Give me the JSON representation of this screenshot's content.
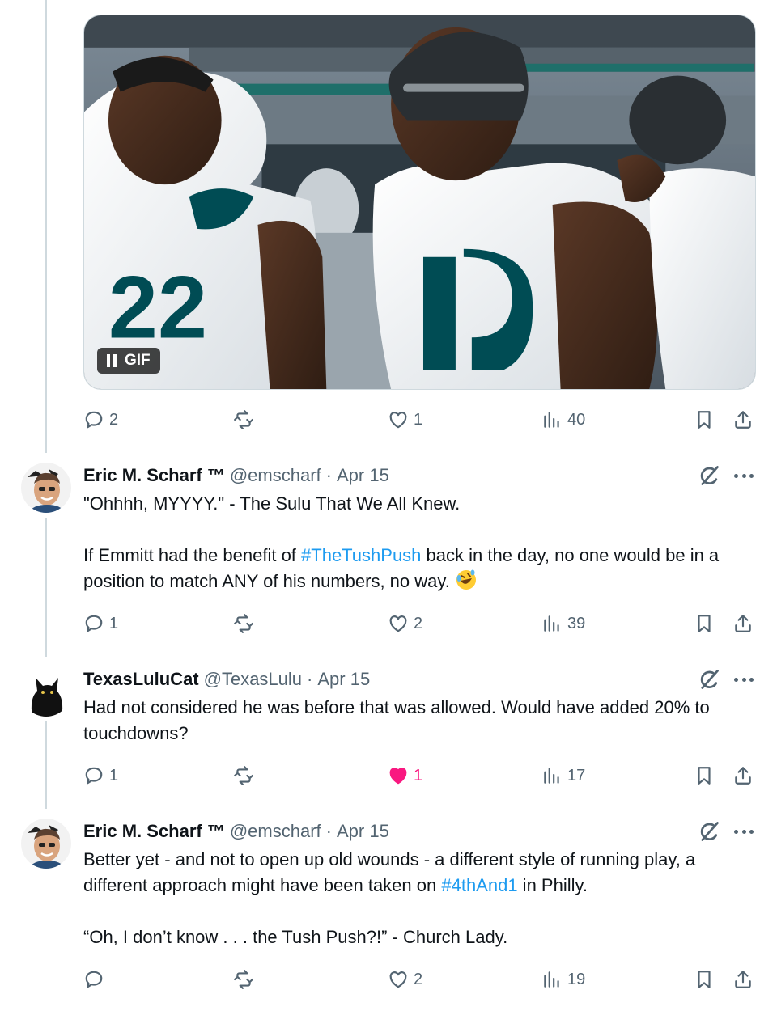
{
  "top_post": {
    "media": {
      "badge_label": "GIF",
      "jersey_left": "22",
      "jersey_right": "19"
    },
    "actions": {
      "replies": "2",
      "reposts": "",
      "likes": "1",
      "views": "40"
    }
  },
  "replies": [
    {
      "name": "Eric M. Scharf ™",
      "handle": "@emscharf",
      "separator": "·",
      "date": "Apr 15",
      "text": {
        "line1": "\"Ohhhh, MYYYY.\" - The Sulu That We All Knew.",
        "p2_before": "If Emmitt had the benefit of ",
        "p2_hashtag": "#TheTushPush",
        "p2_after": " back in the day, no one would be in a position to match ANY of his numbers, no way.",
        "emoji": "rolling-on-floor-laughing"
      },
      "actions": {
        "replies": "1",
        "reposts": "",
        "likes": "2",
        "views": "39",
        "liked": false
      }
    },
    {
      "name": "TexasLuluCat",
      "handle": "@TexasLulu",
      "separator": "·",
      "date": "Apr 15",
      "text": {
        "line1": "Had not considered he was before that was allowed.  Would have added 20% to touchdowns?"
      },
      "actions": {
        "replies": "1",
        "reposts": "",
        "likes": "1",
        "views": "17",
        "liked": true
      }
    },
    {
      "name": "Eric M. Scharf ™",
      "handle": "@emscharf",
      "separator": "·",
      "date": "Apr 15",
      "text": {
        "p1_before": "Better yet - and not to open up old wounds - a different style of running play, a different approach might have been taken on ",
        "p1_hashtag": "#4thAnd1",
        "p1_after": " in Philly.",
        "p2": "“Oh, I don’t know . . . the Tush Push?!” - Church Lady."
      },
      "actions": {
        "replies": "",
        "reposts": "",
        "likes": "2",
        "views": "19",
        "liked": false
      }
    }
  ],
  "colors": {
    "accent": "#1d9bf0",
    "like": "#f91880",
    "muted": "#536471",
    "divider": "#cfd9de"
  },
  "icons": [
    "reply-icon",
    "repost-icon",
    "like-icon",
    "views-icon",
    "bookmark-icon",
    "share-icon",
    "grok-icon",
    "more-icon",
    "pause-icon"
  ]
}
